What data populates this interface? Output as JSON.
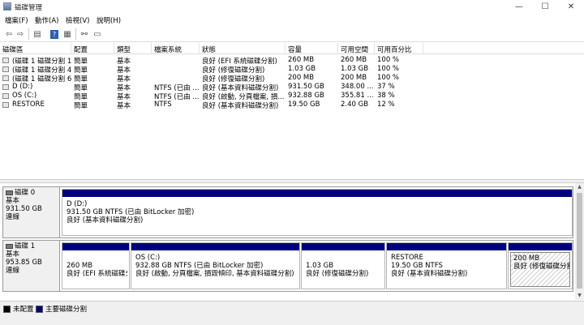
{
  "window": {
    "title": "磁碟管理"
  },
  "menu": [
    "檔案(F)",
    "動作(A)",
    "檢視(V)",
    "說明(H)"
  ],
  "toolbar": {
    "buttons": [
      "back-arrow-icon",
      "forward-arrow-icon",
      "console-icon",
      "help-icon",
      "properties-icon",
      "connect-icon",
      "view-icon"
    ]
  },
  "volumes": {
    "headers": [
      "磁碟區",
      "配置",
      "類型",
      "檔案系統",
      "狀態",
      "容量",
      "可用空間",
      "可用百分比"
    ],
    "rows": [
      [
        "(磁碟 1 磁碟分割 1)",
        "簡單",
        "基本",
        "",
        "良好 (EFI 系統磁碟分割)",
        "260 MB",
        "260 MB",
        "100 %"
      ],
      [
        "(磁碟 1 磁碟分割 4)",
        "簡單",
        "基本",
        "",
        "良好 (修復磁碟分割)",
        "1.03 GB",
        "1.03 GB",
        "100 %"
      ],
      [
        "(磁碟 1 磁碟分割 6)",
        "簡單",
        "基本",
        "",
        "良好 (修復磁碟分割)",
        "200 MB",
        "200 MB",
        "100 %"
      ],
      [
        "D (D:)",
        "簡單",
        "基本",
        "NTFS (已由 ...",
        "良好 (基本資料磁碟分割)",
        "931.50 GB",
        "348.00 ...",
        "37 %"
      ],
      [
        "OS (C:)",
        "簡單",
        "基本",
        "NTFS (已由 ...",
        "良好 (啟動, 分頁檔案, 損...",
        "932.88 GB",
        "355.81 ...",
        "38 %"
      ],
      [
        "RESTORE",
        "簡單",
        "基本",
        "NTFS",
        "良好 (基本資料磁碟分割)",
        "19.50 GB",
        "2.40 GB",
        "12 %"
      ]
    ]
  },
  "disks": [
    {
      "name": "磁碟 0",
      "type": "基本",
      "size": "931.50 GB",
      "status": "連線",
      "partitions": [
        {
          "name": "D  (D:)",
          "size": "931.50 GB NTFS (已由 BitLocker 加密)",
          "status": "良好 (基本資料磁碟分割)"
        }
      ]
    },
    {
      "name": "磁碟 1",
      "type": "基本",
      "size": "953.85 GB",
      "status": "連線",
      "partitions": [
        {
          "name": "",
          "size": "260 MB",
          "status": "良好 (EFI 系統磁碟分割)"
        },
        {
          "name": "OS  (C:)",
          "size": "932.88 GB NTFS (已由 BitLocker 加密)",
          "status": "良好 (啟動, 分頁檔案, 損毀傾印, 基本資料磁碟分割)"
        },
        {
          "name": "",
          "size": "1.03 GB",
          "status": "良好 (修復磁碟分割)"
        },
        {
          "name": "RESTORE",
          "size": "19.50 GB NTFS",
          "status": "良好 (基本資料磁碟分割)"
        },
        {
          "name": "",
          "size": "200 MB",
          "status": "良好 (修復磁碟分割)"
        }
      ]
    }
  ],
  "legend": [
    {
      "label": "未配置",
      "color": "#000000"
    },
    {
      "label": "主要磁碟分割",
      "color": "#00007f"
    }
  ]
}
